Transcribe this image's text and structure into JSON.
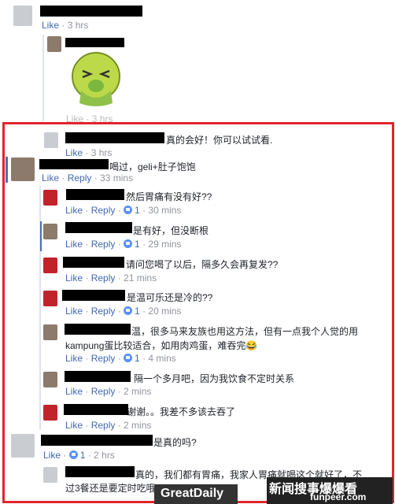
{
  "top_comment": {
    "time": "3 hrs",
    "like": "Like"
  },
  "sticker_reply": {
    "like": "Like",
    "time": "3 hrs"
  },
  "comments": [
    {
      "id": "c1",
      "text": "真的会好！你可以试试看.",
      "like": "Like",
      "time": "3 hrs"
    },
    {
      "id": "c2",
      "text": "喝过，geli+肚子饱饱",
      "like": "Like",
      "reply": "Reply",
      "time": "33 mins"
    },
    {
      "id": "c3",
      "text": "然后胃痛有没有好??",
      "like": "Like",
      "reply": "Reply",
      "count": "1",
      "time": "30 mins"
    },
    {
      "id": "c4",
      "text": "是有好，但没断根",
      "like": "Like",
      "reply": "Reply",
      "count": "1",
      "time": "29 mins"
    },
    {
      "id": "c5",
      "text": "请问您喝了以后，隔多久会再复发??",
      "like": "Like",
      "reply": "Reply",
      "time": "21 mins"
    },
    {
      "id": "c6",
      "text": "是温可乐还是冷的??",
      "like": "Like",
      "reply": "Reply",
      "count": "1",
      "time": "20 mins"
    },
    {
      "id": "c7",
      "text_line1": "温，很多马来友族也用这方法，但有一点我个人觉的用",
      "text_line2": "kampung蛋比较适合，如用肉鸡蛋，难吞完😂",
      "like": "Like",
      "reply": "Reply",
      "count": "1",
      "time": "4 mins"
    },
    {
      "id": "c8",
      "text": "隔一个多月吧，因为我饮食不定时关系",
      "like": "Like",
      "reply": "Reply",
      "time": "2 mins"
    },
    {
      "id": "c9",
      "text": "谢谢。。我差不多该去吞了",
      "like": "Like",
      "reply": "Reply",
      "time": "2 mins"
    },
    {
      "id": "c10",
      "text": "是真的吗?",
      "like": "Like",
      "count": "1",
      "time": "2 hrs"
    },
    {
      "id": "c11",
      "text_line1": "真的，我们都有胃痛，我家人胃痛就喝这个就好了，不",
      "text_line2": "过3餐还是要定时吃哦!"
    }
  ],
  "watermarks": {
    "left": "GreatDaily",
    "right_top": "新闻搜事爆爆看",
    "right_bottom": "funpeer.com"
  }
}
